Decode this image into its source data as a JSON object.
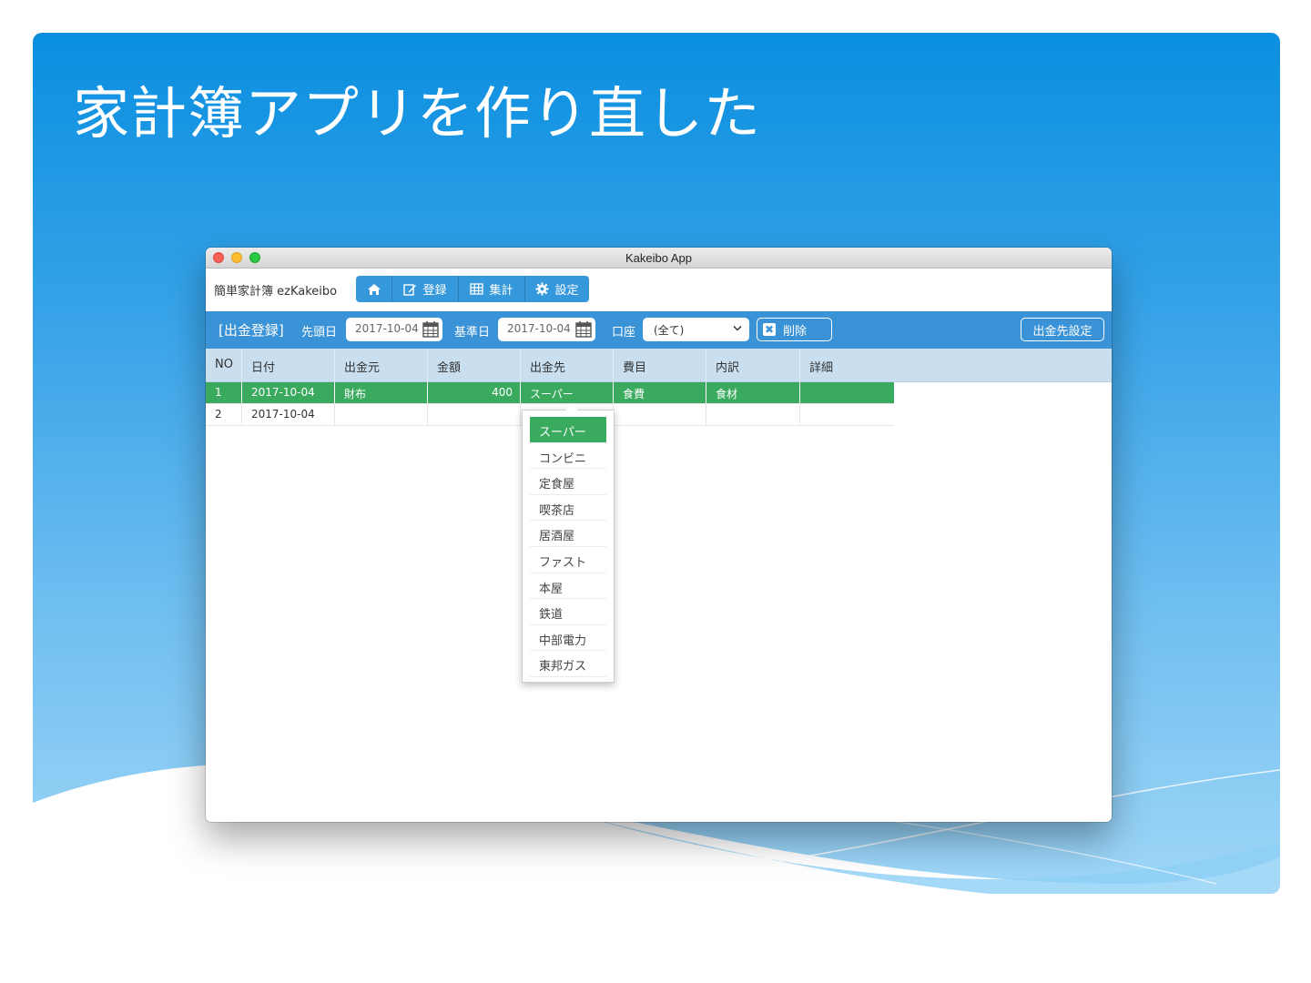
{
  "slide": {
    "title": "家計簿アプリを作り直した"
  },
  "window": {
    "title": "Kakeibo App"
  },
  "navbar": {
    "brand": "簡単家計簿 ezKakeibo",
    "buttons": [
      {
        "icon": "home-icon",
        "label": ""
      },
      {
        "icon": "edit-icon",
        "label": "登録"
      },
      {
        "icon": "table-icon",
        "label": "集計"
      },
      {
        "icon": "gear-icon",
        "label": "設定"
      }
    ]
  },
  "toolbar": {
    "title": "[出金登録]",
    "start_label": "先頭日",
    "start_value": "2017-10-04",
    "base_label": "基準日",
    "base_value": "2017-10-04",
    "account_label": "口座",
    "account_value": "(全て)",
    "delete_label": "削除",
    "dest_settings_label": "出金先設定"
  },
  "table": {
    "headers": [
      "NO",
      "日付",
      "出金元",
      "金額",
      "出金先",
      "費目",
      "内訳",
      "詳細"
    ],
    "rows": [
      {
        "no": "1",
        "date": "2017-10-04",
        "source": "財布",
        "amount": "400",
        "dest": "スーパー",
        "category": "食費",
        "breakdown": "食材",
        "detail": ""
      },
      {
        "no": "2",
        "date": "2017-10-04",
        "source": "",
        "amount": "",
        "dest": "",
        "category": "",
        "breakdown": "",
        "detail": ""
      }
    ]
  },
  "dropdown": {
    "selected": "スーパー",
    "options": [
      "スーパー",
      "コンビニ",
      "定食屋",
      "喫茶店",
      "居酒屋",
      "ファスト",
      "本屋",
      "鉄道",
      "中部電力",
      "東邦ガス"
    ]
  },
  "colors": {
    "toolbar": "#3a93d6",
    "nav_button": "#3498db",
    "selection": "#3aaa5e",
    "header": "#c9dff0"
  }
}
